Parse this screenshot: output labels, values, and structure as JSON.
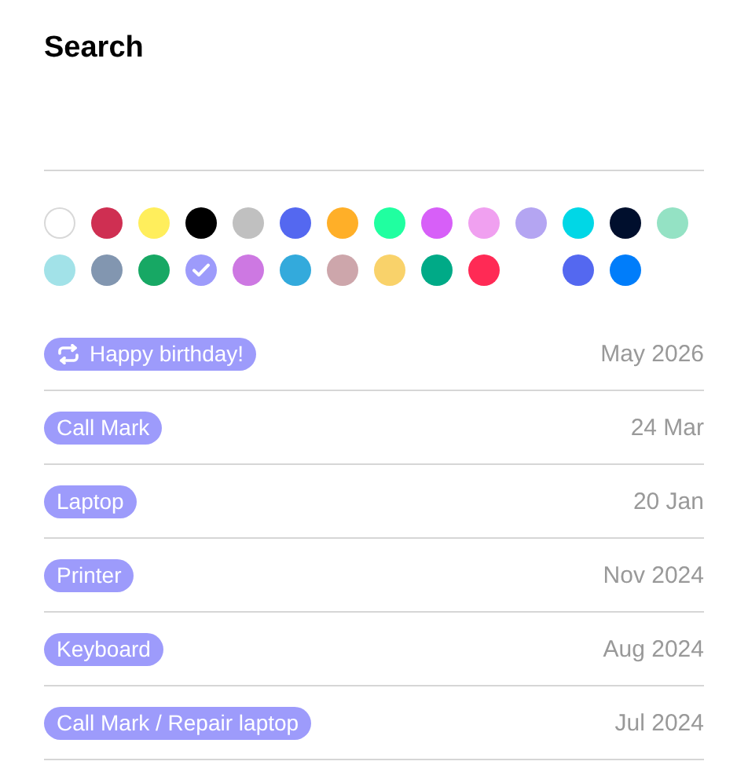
{
  "title": "Search",
  "swatches": [
    {
      "kind": "swatch",
      "color": "#ffffff",
      "selected": false
    },
    {
      "kind": "swatch",
      "color": "#cf2f52",
      "selected": false
    },
    {
      "kind": "swatch",
      "color": "#ffee5c",
      "selected": false
    },
    {
      "kind": "swatch",
      "color": "#000000",
      "selected": false
    },
    {
      "kind": "swatch",
      "color": "#c0c0c0",
      "selected": false
    },
    {
      "kind": "swatch",
      "color": "#5468f0",
      "selected": false
    },
    {
      "kind": "swatch",
      "color": "#ffaf28",
      "selected": false
    },
    {
      "kind": "swatch",
      "color": "#20ffa0",
      "selected": false
    },
    {
      "kind": "swatch",
      "color": "#d75ff8",
      "selected": false
    },
    {
      "kind": "swatch",
      "color": "#f0a0f0",
      "selected": false
    },
    {
      "kind": "swatch",
      "color": "#b4a5f2",
      "selected": false
    },
    {
      "kind": "swatch",
      "color": "#00d7e6",
      "selected": false
    },
    {
      "kind": "swatch",
      "color": "#000f2d",
      "selected": false
    },
    {
      "kind": "swatch",
      "color": "#94e2c4",
      "selected": false
    },
    {
      "kind": "swatch",
      "color": "#a2e2e8",
      "selected": false
    },
    {
      "kind": "swatch",
      "color": "#8296b0",
      "selected": false
    },
    {
      "kind": "swatch",
      "color": "#17a864",
      "selected": false
    },
    {
      "kind": "swatch",
      "color": "#9d9bfb",
      "selected": true
    },
    {
      "kind": "swatch",
      "color": "#cd78e2",
      "selected": false
    },
    {
      "kind": "swatch",
      "color": "#33aadc",
      "selected": false
    },
    {
      "kind": "swatch",
      "color": "#cda6ab",
      "selected": false
    },
    {
      "kind": "swatch",
      "color": "#f9d26a",
      "selected": false
    },
    {
      "kind": "swatch",
      "color": "#00aa87",
      "selected": false
    },
    {
      "kind": "swatch",
      "color": "#ff2a55",
      "selected": false
    },
    {
      "kind": "gap"
    },
    {
      "kind": "swatch",
      "color": "#5468f0",
      "selected": false
    },
    {
      "kind": "swatch",
      "color": "#007dfa",
      "selected": false
    }
  ],
  "results": [
    {
      "label": "Happy birthday!",
      "recurring": true,
      "date": "May 2026"
    },
    {
      "label": "Call Mark",
      "recurring": false,
      "date": "24 Mar"
    },
    {
      "label": "Laptop",
      "recurring": false,
      "date": "20 Jan"
    },
    {
      "label": "Printer",
      "recurring": false,
      "date": "Nov 2024"
    },
    {
      "label": "Keyboard",
      "recurring": false,
      "date": "Aug 2024"
    },
    {
      "label": "Call Mark / Repair laptop",
      "recurring": false,
      "date": "Jul 2024"
    }
  ]
}
